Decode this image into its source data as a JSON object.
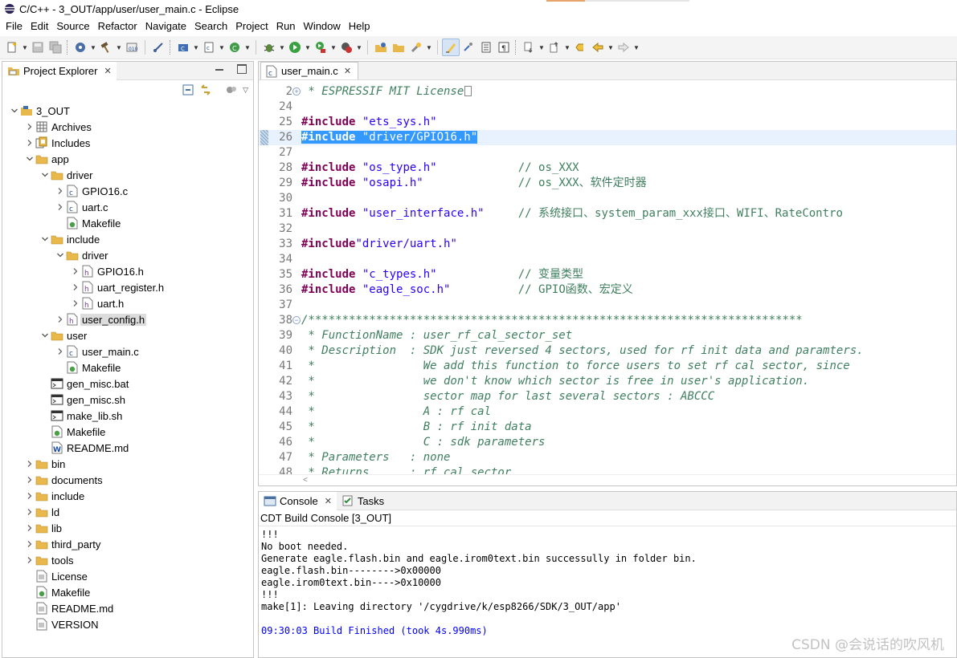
{
  "window": {
    "title": "C/C++ - 3_OUT/app/user/user_main.c - Eclipse"
  },
  "menu": [
    "File",
    "Edit",
    "Source",
    "Refactor",
    "Navigate",
    "Search",
    "Project",
    "Run",
    "Window",
    "Help"
  ],
  "explorer": {
    "tab_label": "Project Explorer",
    "tree": [
      {
        "label": "3_OUT",
        "level": 0,
        "state": "open",
        "icon": "project-icon"
      },
      {
        "label": "Archives",
        "level": 1,
        "state": "closed",
        "icon": "archives-icon"
      },
      {
        "label": "Includes",
        "level": 1,
        "state": "closed",
        "icon": "includes-icon"
      },
      {
        "label": "app",
        "level": 1,
        "state": "open",
        "icon": "folder-icon"
      },
      {
        "label": "driver",
        "level": 2,
        "state": "open",
        "icon": "folder-icon"
      },
      {
        "label": "GPIO16.c",
        "level": 3,
        "state": "closed",
        "icon": "c-file-icon"
      },
      {
        "label": "uart.c",
        "level": 3,
        "state": "closed",
        "icon": "c-file-icon"
      },
      {
        "label": "Makefile",
        "level": 3,
        "state": "none",
        "icon": "makefile-icon"
      },
      {
        "label": "include",
        "level": 2,
        "state": "open",
        "icon": "folder-icon"
      },
      {
        "label": "driver",
        "level": 3,
        "state": "open",
        "icon": "folder-icon"
      },
      {
        "label": "GPIO16.h",
        "level": 4,
        "state": "closed",
        "icon": "h-file-icon"
      },
      {
        "label": "uart_register.h",
        "level": 4,
        "state": "closed",
        "icon": "h-file-icon"
      },
      {
        "label": "uart.h",
        "level": 4,
        "state": "closed",
        "icon": "h-file-icon"
      },
      {
        "label": "user_config.h",
        "level": 3,
        "state": "closed",
        "icon": "h-file-icon",
        "selected": true
      },
      {
        "label": "user",
        "level": 2,
        "state": "open",
        "icon": "folder-icon"
      },
      {
        "label": "user_main.c",
        "level": 3,
        "state": "closed",
        "icon": "c-file-icon"
      },
      {
        "label": "Makefile",
        "level": 3,
        "state": "none",
        "icon": "makefile-icon"
      },
      {
        "label": "gen_misc.bat",
        "level": 2,
        "state": "none",
        "icon": "script-icon"
      },
      {
        "label": "gen_misc.sh",
        "level": 2,
        "state": "none",
        "icon": "script-icon"
      },
      {
        "label": "make_lib.sh",
        "level": 2,
        "state": "none",
        "icon": "script-icon"
      },
      {
        "label": "Makefile",
        "level": 2,
        "state": "none",
        "icon": "makefile-icon"
      },
      {
        "label": "README.md",
        "level": 2,
        "state": "none",
        "icon": "word-file-icon"
      },
      {
        "label": "bin",
        "level": 1,
        "state": "closed",
        "icon": "folder-icon"
      },
      {
        "label": "documents",
        "level": 1,
        "state": "closed",
        "icon": "folder-icon"
      },
      {
        "label": "include",
        "level": 1,
        "state": "closed",
        "icon": "folder-icon"
      },
      {
        "label": "ld",
        "level": 1,
        "state": "closed",
        "icon": "folder-icon"
      },
      {
        "label": "lib",
        "level": 1,
        "state": "closed",
        "icon": "folder-icon"
      },
      {
        "label": "third_party",
        "level": 1,
        "state": "closed",
        "icon": "folder-icon"
      },
      {
        "label": "tools",
        "level": 1,
        "state": "closed",
        "icon": "folder-icon"
      },
      {
        "label": "License",
        "level": 1,
        "state": "none",
        "icon": "text-file-icon"
      },
      {
        "label": "Makefile",
        "level": 1,
        "state": "none",
        "icon": "makefile-icon"
      },
      {
        "label": "README.md",
        "level": 1,
        "state": "none",
        "icon": "text-file-icon"
      },
      {
        "label": "VERSION",
        "level": 1,
        "state": "none",
        "icon": "text-file-icon"
      }
    ]
  },
  "editor": {
    "tab_label": "user_main.c",
    "lines": [
      {
        "n": "2",
        "fold": "plus",
        "tokens": [
          {
            "t": " * ESPRESSIF MIT License",
            "c": "cm"
          }
        ],
        "foldbox": true
      },
      {
        "n": "24",
        "tokens": []
      },
      {
        "n": "25",
        "tokens": [
          {
            "t": "#include",
            "c": "kw"
          },
          {
            "t": " "
          },
          {
            "t": "\"ets_sys.h\"",
            "c": "str"
          }
        ]
      },
      {
        "n": "26",
        "current": true,
        "selected": true,
        "tokens": [
          {
            "t": "#include",
            "c": "kw"
          },
          {
            "t": " "
          },
          {
            "t": "\"driver/GPIO16.h\"",
            "c": "str"
          }
        ]
      },
      {
        "n": "27",
        "tokens": []
      },
      {
        "n": "28",
        "tokens": [
          {
            "t": "#include",
            "c": "kw"
          },
          {
            "t": " "
          },
          {
            "t": "\"os_type.h\"",
            "c": "str"
          },
          {
            "t": "            "
          },
          {
            "t": "// os_XXX",
            "c": "cm"
          }
        ]
      },
      {
        "n": "29",
        "tokens": [
          {
            "t": "#include",
            "c": "kw"
          },
          {
            "t": " "
          },
          {
            "t": "\"osapi.h\"",
            "c": "str"
          },
          {
            "t": "              "
          },
          {
            "t": "// os_XXX、软件定时器",
            "c": "cm"
          }
        ]
      },
      {
        "n": "30",
        "tokens": []
      },
      {
        "n": "31",
        "tokens": [
          {
            "t": "#include",
            "c": "kw"
          },
          {
            "t": " "
          },
          {
            "t": "\"user_interface.h\"",
            "c": "str"
          },
          {
            "t": "     "
          },
          {
            "t": "// 系统接口、system_param_xxx接口、WIFI、RateContro",
            "c": "cm"
          }
        ]
      },
      {
        "n": "32",
        "tokens": []
      },
      {
        "n": "33",
        "tokens": [
          {
            "t": "#include",
            "c": "kw"
          },
          {
            "t": "\"driver/uart.h\"",
            "c": "str"
          }
        ]
      },
      {
        "n": "34",
        "tokens": []
      },
      {
        "n": "35",
        "tokens": [
          {
            "t": "#include",
            "c": "kw"
          },
          {
            "t": " "
          },
          {
            "t": "\"c_types.h\"",
            "c": "str"
          },
          {
            "t": "            "
          },
          {
            "t": "// 变量类型",
            "c": "cm"
          }
        ]
      },
      {
        "n": "36",
        "tokens": [
          {
            "t": "#include",
            "c": "kw"
          },
          {
            "t": " "
          },
          {
            "t": "\"eagle_soc.h\"",
            "c": "str"
          },
          {
            "t": "          "
          },
          {
            "t": "// GPIO函数、宏定义",
            "c": "cm"
          }
        ]
      },
      {
        "n": "37",
        "tokens": []
      },
      {
        "n": "38",
        "fold": "minus",
        "tokens": [
          {
            "t": "/*************************************************************************",
            "c": "cm"
          }
        ]
      },
      {
        "n": "39",
        "tokens": [
          {
            "t": " * FunctionName : user_rf_cal_sector_set",
            "c": "cm"
          }
        ]
      },
      {
        "n": "40",
        "tokens": [
          {
            "t": " * Description  : SDK just reversed 4 sectors, used for rf init data and paramters.",
            "c": "cm"
          }
        ]
      },
      {
        "n": "41",
        "tokens": [
          {
            "t": " *                We add this function to force users to set rf cal sector, since",
            "c": "cm"
          }
        ]
      },
      {
        "n": "42",
        "tokens": [
          {
            "t": " *                we don't know which sector is free in user's application.",
            "c": "cm"
          }
        ]
      },
      {
        "n": "43",
        "tokens": [
          {
            "t": " *                sector map for last several sectors : ABCCC",
            "c": "cm"
          }
        ]
      },
      {
        "n": "44",
        "tokens": [
          {
            "t": " *                A : rf cal",
            "c": "cm"
          }
        ]
      },
      {
        "n": "45",
        "tokens": [
          {
            "t": " *                B : rf init data",
            "c": "cm"
          }
        ]
      },
      {
        "n": "46",
        "tokens": [
          {
            "t": " *                C : sdk parameters",
            "c": "cm"
          }
        ]
      },
      {
        "n": "47",
        "tokens": [
          {
            "t": " * Parameters   : none",
            "c": "cm"
          }
        ]
      },
      {
        "n": "48",
        "tokens": [
          {
            "t": " * Returns      : rf cal sector",
            "c": "cm"
          }
        ]
      }
    ]
  },
  "console": {
    "tabs": [
      "Console",
      "Tasks"
    ],
    "title": "CDT Build Console [3_OUT]",
    "lines": [
      {
        "text": "!!!"
      },
      {
        "text": "No boot needed."
      },
      {
        "text": "Generate eagle.flash.bin and eagle.irom0text.bin successully in folder bin."
      },
      {
        "text": "eagle.flash.bin-------->0x00000"
      },
      {
        "text": "eagle.irom0text.bin---->0x10000"
      },
      {
        "text": "!!!"
      },
      {
        "text": "make[1]: Leaving directory '/cygdrive/k/esp8266/SDK/3_OUT/app'"
      },
      {
        "text": ""
      },
      {
        "text": "09:30:03 Build Finished (took 4s.990ms)",
        "color": "blue"
      }
    ]
  },
  "watermark": "CSDN @会说话的吹风机"
}
